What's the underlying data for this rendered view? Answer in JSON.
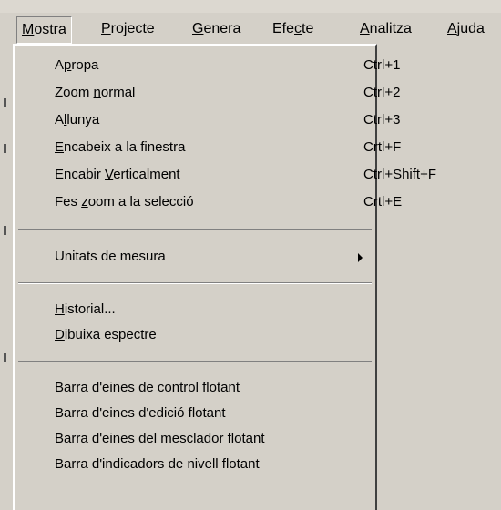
{
  "menubar": {
    "items": [
      {
        "pre": "",
        "key": "M",
        "post": "ostra"
      },
      {
        "pre": "",
        "key": "P",
        "post": "rojecte"
      },
      {
        "pre": "",
        "key": "G",
        "post": "enera"
      },
      {
        "pre": "Efe",
        "key": "c",
        "post": "te"
      },
      {
        "pre": "",
        "key": "A",
        "post": "nalitza"
      },
      {
        "pre": "",
        "key": "A",
        "post": "juda"
      }
    ]
  },
  "menu": {
    "items": [
      {
        "pre": "A",
        "key": "p",
        "post": "ropa",
        "shortcut": "Ctrl+1"
      },
      {
        "pre": "Zoom ",
        "key": "n",
        "post": "ormal",
        "shortcut": "Ctrl+2"
      },
      {
        "pre": "A",
        "key": "l",
        "post": "lunya",
        "shortcut": "Ctrl+3"
      },
      {
        "pre": "",
        "key": "E",
        "post": "ncabeix a la finestra",
        "shortcut": "Crtl+F"
      },
      {
        "pre": "Encabir ",
        "key": "V",
        "post": "erticalment",
        "shortcut": "Ctrl+Shift+F"
      },
      {
        "pre": "Fes ",
        "key": "z",
        "post": "oom a la selecció",
        "shortcut": "Crtl+E"
      },
      {
        "pre": "Unitats de mesura",
        "key": "",
        "post": "",
        "shortcut": ""
      },
      {
        "pre": "",
        "key": "H",
        "post": "istorial...",
        "shortcut": ""
      },
      {
        "pre": "",
        "key": "D",
        "post": "ibuixa espectre",
        "shortcut": ""
      },
      {
        "pre": "Barra d'eines de control flotant",
        "key": "",
        "post": "",
        "shortcut": ""
      },
      {
        "pre": "Barra d'eines d'edició flotant",
        "key": "",
        "post": "",
        "shortcut": ""
      },
      {
        "pre": "Barra d'eines del mesclador flotant",
        "key": "",
        "post": "",
        "shortcut": ""
      },
      {
        "pre": "Barra d'indicadors de nivell flotant",
        "key": "",
        "post": "",
        "shortcut": ""
      }
    ]
  },
  "icons": {
    "submenu_arrow": "chevron-right-icon"
  },
  "colors": {
    "menu_bg": "#d4d0c8",
    "text": "#000000"
  }
}
